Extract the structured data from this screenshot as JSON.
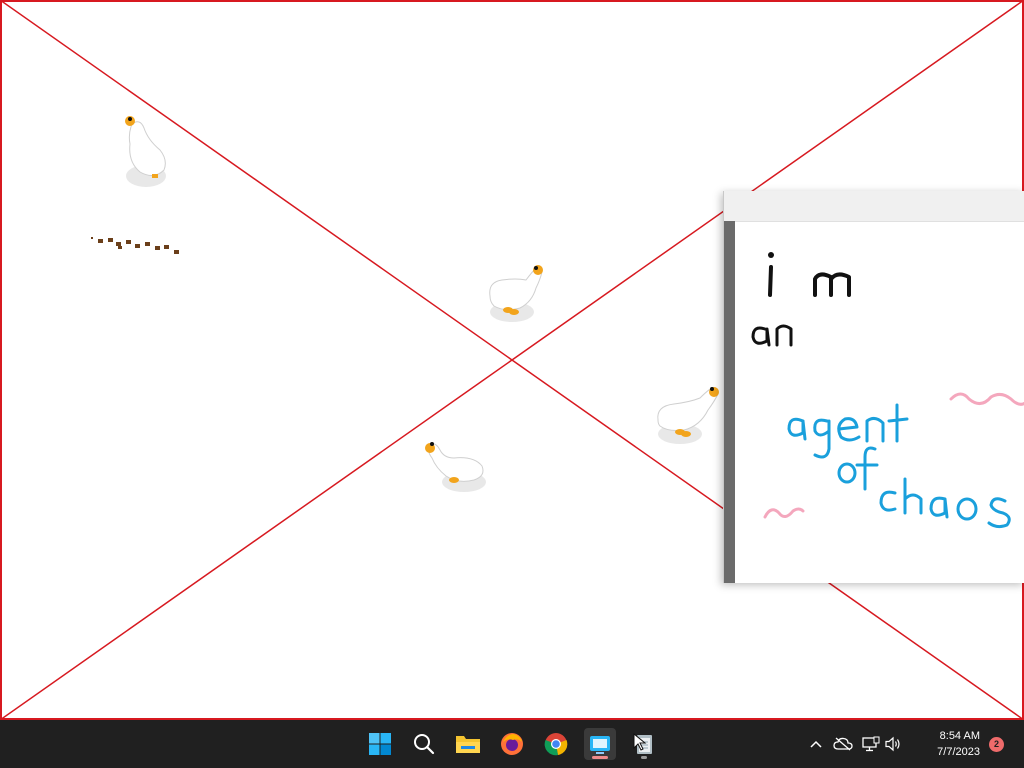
{
  "desktop": {
    "background": "#ffffff",
    "cross_color": "#d71920",
    "handwriting": {
      "line1": "i m",
      "line2": "an",
      "line3": "agent",
      "line4": "of",
      "line5": "chaos",
      "black_color": "#111111",
      "blue_color": "#1aa0dc",
      "pink_color": "#f4a7bd"
    }
  },
  "taskbar": {
    "background": "#202020",
    "items": [
      {
        "name": "windows-start",
        "icon": "windows-logo-icon"
      },
      {
        "name": "search",
        "icon": "search-icon"
      },
      {
        "name": "file-explorer",
        "icon": "folder-icon"
      },
      {
        "name": "firefox",
        "icon": "firefox-icon"
      },
      {
        "name": "chrome",
        "icon": "chrome-icon"
      },
      {
        "name": "active-app",
        "icon": "app-window-icon",
        "active": true
      },
      {
        "name": "notepad",
        "icon": "notepad-icon"
      }
    ],
    "tray": {
      "icons": [
        "chevron-up-icon",
        "cloud-off-icon",
        "network-icon",
        "volume-icon"
      ]
    },
    "clock": {
      "time": "8:54 AM",
      "date": "7/7/2023"
    },
    "notification_count": "2",
    "active_indicator_color": "#ef8b8b",
    "badge_color": "#ef6b6b"
  }
}
